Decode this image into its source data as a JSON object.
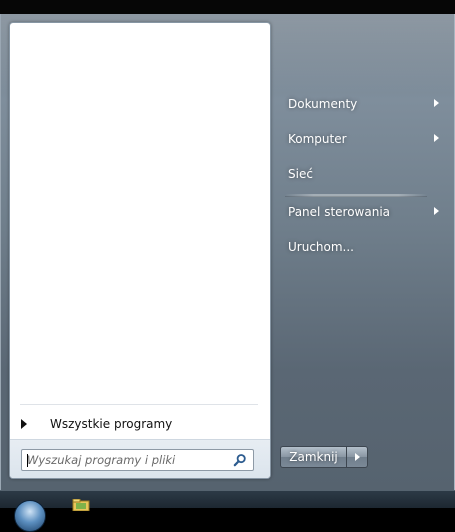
{
  "start_menu": {
    "all_programs_label": "Wszystkie programy",
    "search": {
      "placeholder": "Wyszukaj programy i pliki",
      "value": "",
      "icon": "search-icon"
    },
    "right_items": [
      {
        "label": "Dokumenty",
        "has_submenu": true
      },
      {
        "label": "Komputer",
        "has_submenu": true
      },
      {
        "label": "Sieć",
        "has_submenu": false
      },
      {
        "label": "Panel sterowania",
        "has_submenu": true
      },
      {
        "label": "Uruchom...",
        "has_submenu": false
      }
    ],
    "shutdown_label": "Zamknij"
  },
  "taskbar": {
    "icons": [
      "start-orb",
      "folder-icon"
    ]
  },
  "colors": {
    "menu_background": "#6f7e8b",
    "left_pane": "#ffffff",
    "search_area": "#dbe4ec",
    "text_light": "#ffffff",
    "text_dark": "#111111"
  }
}
